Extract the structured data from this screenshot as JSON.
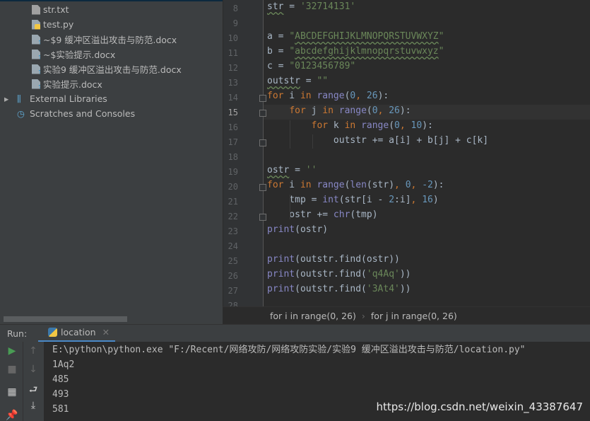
{
  "project": {
    "files": [
      {
        "name": "str.txt",
        "icon": "text-file-icon"
      },
      {
        "name": "test.py",
        "icon": "python-file-icon"
      },
      {
        "name": "~$9 缓冲区溢出攻击与防范.docx",
        "icon": "unknown-file-icon"
      },
      {
        "name": "~$实验提示.docx",
        "icon": "unknown-file-icon"
      },
      {
        "name": "实验9 缓冲区溢出攻击与防范.docx",
        "icon": "unknown-file-icon"
      },
      {
        "name": "实验提示.docx",
        "icon": "unknown-file-icon"
      }
    ],
    "external_libraries": "External Libraries",
    "scratches": "Scratches and Consoles"
  },
  "editor": {
    "current_line": 15,
    "lines": [
      {
        "n": "8",
        "t": [
          [
            "d w",
            "str"
          ],
          [
            "d",
            " = "
          ],
          [
            "s",
            "'32714131'"
          ]
        ]
      },
      {
        "n": "9",
        "t": []
      },
      {
        "n": "10",
        "t": [
          [
            "d",
            "a = "
          ],
          [
            "s",
            "\""
          ],
          [
            "s w",
            "ABCDEFGHIJKLMNOPQRSTUVWXYZ"
          ],
          [
            "s",
            "\""
          ]
        ]
      },
      {
        "n": "11",
        "t": [
          [
            "d",
            "b = "
          ],
          [
            "s",
            "\""
          ],
          [
            "s w",
            "abcdefghijklmnopqrstuvwxyz"
          ],
          [
            "s",
            "\""
          ]
        ]
      },
      {
        "n": "12",
        "t": [
          [
            "d",
            "c = "
          ],
          [
            "s",
            "\"0123456789\""
          ]
        ]
      },
      {
        "n": "13",
        "t": [
          [
            "d w",
            "outstr"
          ],
          [
            "d",
            " = "
          ],
          [
            "s",
            "\"\""
          ]
        ]
      },
      {
        "n": "14",
        "t": [
          [
            "k",
            "for"
          ],
          [
            "d",
            " i "
          ],
          [
            "k",
            "in"
          ],
          [
            "d",
            " "
          ],
          [
            "b",
            "range"
          ],
          [
            "d",
            "("
          ],
          [
            "n",
            "0"
          ],
          [
            "k",
            ", "
          ],
          [
            "n",
            "26"
          ],
          [
            "d",
            "):"
          ]
        ]
      },
      {
        "n": "15",
        "t": [
          [
            "d",
            "    "
          ],
          [
            "k",
            "for"
          ],
          [
            "d",
            " j "
          ],
          [
            "k",
            "in"
          ],
          [
            "d",
            " "
          ],
          [
            "b",
            "range"
          ],
          [
            "d",
            "("
          ],
          [
            "n",
            "0"
          ],
          [
            "k",
            ", "
          ],
          [
            "n",
            "26"
          ],
          [
            "d",
            "):"
          ]
        ]
      },
      {
        "n": "16",
        "t": [
          [
            "d",
            "        "
          ],
          [
            "k",
            "for"
          ],
          [
            "d",
            " k "
          ],
          [
            "k",
            "in"
          ],
          [
            "d",
            " "
          ],
          [
            "b",
            "range"
          ],
          [
            "d",
            "("
          ],
          [
            "n",
            "0"
          ],
          [
            "k",
            ", "
          ],
          [
            "n",
            "10"
          ],
          [
            "d",
            "):"
          ]
        ]
      },
      {
        "n": "17",
        "t": [
          [
            "d",
            "            outstr += a[i] + b[j] + c[k]"
          ]
        ]
      },
      {
        "n": "18",
        "t": []
      },
      {
        "n": "19",
        "t": [
          [
            "d w",
            "ostr"
          ],
          [
            "d",
            " = "
          ],
          [
            "s",
            "''"
          ]
        ]
      },
      {
        "n": "20",
        "t": [
          [
            "k",
            "for"
          ],
          [
            "d",
            " i "
          ],
          [
            "k",
            "in"
          ],
          [
            "d",
            " "
          ],
          [
            "b",
            "range"
          ],
          [
            "d",
            "("
          ],
          [
            "b",
            "len"
          ],
          [
            "d",
            "(str)"
          ],
          [
            "k",
            ", "
          ],
          [
            "n",
            "0"
          ],
          [
            "k",
            ", "
          ],
          [
            "n",
            "-2"
          ],
          [
            "d",
            "):"
          ]
        ]
      },
      {
        "n": "21",
        "t": [
          [
            "d",
            "    tmp = "
          ],
          [
            "b",
            "int"
          ],
          [
            "d",
            "(str[i - "
          ],
          [
            "n",
            "2"
          ],
          [
            "d",
            ":i]"
          ],
          [
            "k",
            ", "
          ],
          [
            "n",
            "16"
          ],
          [
            "d",
            ")"
          ]
        ]
      },
      {
        "n": "22",
        "t": [
          [
            "d",
            "    ostr += "
          ],
          [
            "b",
            "chr"
          ],
          [
            "d",
            "(tmp)"
          ]
        ]
      },
      {
        "n": "23",
        "t": [
          [
            "b",
            "print"
          ],
          [
            "d",
            "(ostr)"
          ]
        ]
      },
      {
        "n": "24",
        "t": []
      },
      {
        "n": "25",
        "t": [
          [
            "b",
            "print"
          ],
          [
            "d",
            "(outstr.find(ostr))"
          ]
        ]
      },
      {
        "n": "26",
        "t": [
          [
            "b",
            "print"
          ],
          [
            "d",
            "(outstr.find("
          ],
          [
            "s",
            "'q4Aq'"
          ],
          [
            "d",
            "))"
          ]
        ]
      },
      {
        "n": "27",
        "t": [
          [
            "b",
            "print"
          ],
          [
            "d",
            "(outstr.find("
          ],
          [
            "s",
            "'3At4'"
          ],
          [
            "d",
            "))"
          ]
        ]
      },
      {
        "n": "28",
        "t": []
      }
    ]
  },
  "breadcrumb": [
    "for i in range(0, 26)",
    "for j in range(0, 26)"
  ],
  "run": {
    "label": "Run:",
    "tab": "location",
    "output": [
      "E:\\python\\python.exe \"F:/Recent/网络攻防/网络攻防实验/实验9 缓冲区溢出攻击与防范/location.py\"",
      "1Aq2",
      "485",
      "493",
      "581"
    ]
  },
  "watermark": "https://blog.csdn.net/weixin_43387647"
}
